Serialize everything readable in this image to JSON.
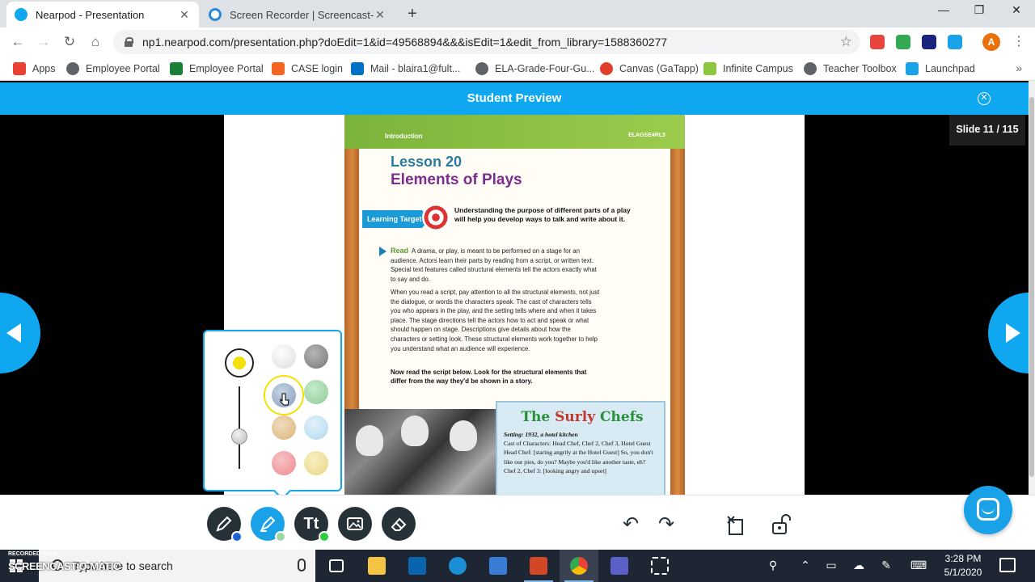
{
  "browser": {
    "tabs": [
      {
        "title": "Nearpod - Presentation",
        "active": true
      },
      {
        "title": "Screen Recorder | Screencast-O-M",
        "active": false
      }
    ],
    "url": "np1.nearpod.com/presentation.php?doEdit=1&id=49568894&&&isEdit=1&edit_from_library=1588360277",
    "profile_initial": "A"
  },
  "bookmarks": [
    {
      "label": "Apps",
      "color": "#ea4335"
    },
    {
      "label": "Employee Portal",
      "color": "#5f6368"
    },
    {
      "label": "Employee Portal",
      "color": "#1a7f37"
    },
    {
      "label": "CASE login",
      "color": "#f26522"
    },
    {
      "label": "Mail - blaira1@fult...",
      "color": "#0072c6"
    },
    {
      "label": "ELA-Grade-Four-Gu...",
      "color": "#5f6368"
    },
    {
      "label": "Canvas (GaTapp)",
      "color": "#e13f2b"
    },
    {
      "label": "Infinite Campus",
      "color": "#8dc63f"
    },
    {
      "label": "Teacher Toolbox",
      "color": "#5f6368"
    },
    {
      "label": "Launchpad",
      "color": "#1aa2e8"
    }
  ],
  "nearpod": {
    "header_title": "Student Preview",
    "slide_counter": "Slide 11 / 115"
  },
  "slide": {
    "section": "Introduction",
    "standard": "ELAGSE4RL5",
    "lesson_number": "Lesson 20",
    "lesson_title": "Elements of Plays",
    "learning_target_label": "Learning Target",
    "learning_target_text": "Understanding the purpose of different parts of a play will help you develop ways to talk and write about it.",
    "read_word": "Read",
    "para1": "A drama, or play, is meant to be performed on a stage for an audience. Actors learn their parts by reading from a script, or written text. Special text features called structural elements tell the actors exactly what to say and do.",
    "para2": "When you read a script, pay attention to all the structural elements, not just the dialogue, or words the characters speak. The cast of characters tells you who appears in the play, and the setting tells where and when it takes place. The stage directions tell the actors how to act and speak or what should happen on stage. Descriptions give details about how the characters or setting look. These structural elements work together to help you understand what an audience will experience.",
    "instruction": "Now read the script below. Look for the structural elements that differ from the way they'd be shown in a story.",
    "script_title_a": "The ",
    "script_title_b": "Surly",
    "script_title_c": " Chefs",
    "script_lines": [
      "Setting: 1932, a hotel kitchen",
      "Cast of Characters: Head Chef, Chef 2, Chef 3, Hotel Guest",
      "Head Chef: [staring angrily at the Hotel Guest] So, you don't like our pies, do you? Maybe you'd like another taste, eh?",
      "Chef 2, Chef 3: [looking angry and upset]"
    ]
  },
  "color_picker": {
    "current_color": "#f5e10a",
    "swatches": [
      "#e6e6e6",
      "#8a8a8a",
      "#9aaec8",
      "#9fd6a6",
      "#e2c08e",
      "#bfe0f2",
      "#f19a9f",
      "#ecdf95"
    ],
    "selected_index": 2
  },
  "toolbar": {
    "tools": [
      "pen-tool",
      "highlighter-tool",
      "text-tool",
      "image-tool",
      "eraser-tool"
    ],
    "text_tool_label": "Tt",
    "pen_badge_color": "#1e63d6",
    "text_badge_color": "#2ecc40"
  },
  "taskbar": {
    "search_placeholder": "Type here to search",
    "time": "3:28 PM",
    "date": "5/1/2020",
    "watermark_top": "RECORDED WITH",
    "watermark_bottom": "SCREENCAST-O-MATIC"
  }
}
